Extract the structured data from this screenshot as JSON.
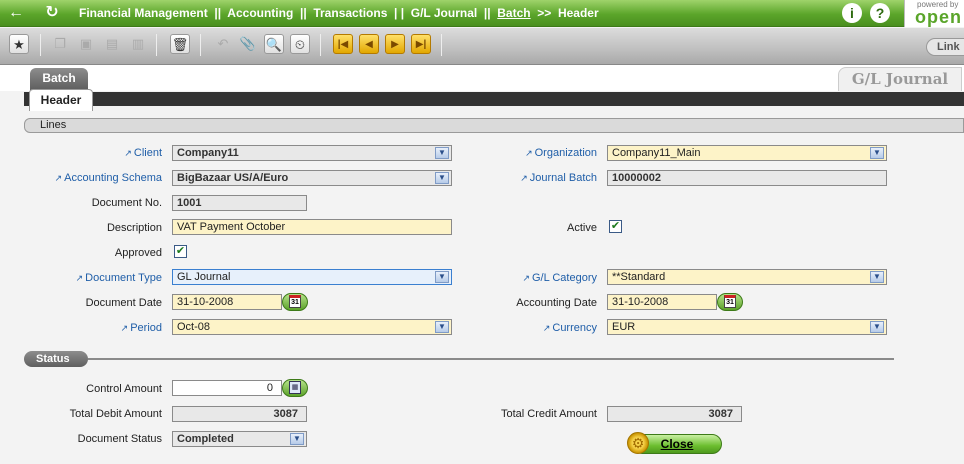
{
  "breadcrumb": {
    "prefix": "Financial Management  ||  Accounting  ||  Transactions  | |  G/L Journal  ||  ",
    "link": "Batch",
    "suffix": "  >>  Header"
  },
  "branding": {
    "powered_by": "powered by",
    "logo_text": "open"
  },
  "header_icons": {
    "info": "i",
    "help": "?"
  },
  "link_button": "Link",
  "tabs": {
    "batch": "Batch",
    "header": "Header",
    "window_title": "G/L Journal",
    "lines": "Lines"
  },
  "fields": {
    "client": {
      "label": "Client",
      "value": "Company11"
    },
    "organization": {
      "label": "Organization",
      "value": "Company11_Main"
    },
    "accounting_schema": {
      "label": "Accounting Schema",
      "value": "BigBazaar US/A/Euro"
    },
    "journal_batch": {
      "label": "Journal Batch",
      "value": "10000002"
    },
    "document_no": {
      "label": "Document No.",
      "value": "1001"
    },
    "description": {
      "label": "Description",
      "value": "VAT Payment October"
    },
    "active": {
      "label": "Active",
      "checked": true
    },
    "approved": {
      "label": "Approved",
      "checked": true
    },
    "document_type": {
      "label": "Document Type",
      "value": "GL Journal"
    },
    "gl_category": {
      "label": "G/L Category",
      "value": "**Standard"
    },
    "document_date": {
      "label": "Document Date",
      "value": "31-10-2008"
    },
    "accounting_date": {
      "label": "Accounting Date",
      "value": "31-10-2008"
    },
    "period": {
      "label": "Period",
      "value": "Oct-08"
    },
    "currency": {
      "label": "Currency",
      "value": "EUR"
    }
  },
  "status": {
    "title": "Status",
    "control_amount": {
      "label": "Control Amount",
      "value": "0"
    },
    "total_debit": {
      "label": "Total Debit Amount",
      "value": "3087"
    },
    "total_credit": {
      "label": "Total Credit Amount",
      "value": "3087"
    },
    "document_status": {
      "label": "Document Status",
      "value": "Completed"
    },
    "close_button": "Close"
  },
  "calendar_glyph": "31",
  "colors": {
    "brand_green": "#5ba52a",
    "required_label": "#1f5ea8",
    "mandatory_field": "#fdf3c8"
  }
}
